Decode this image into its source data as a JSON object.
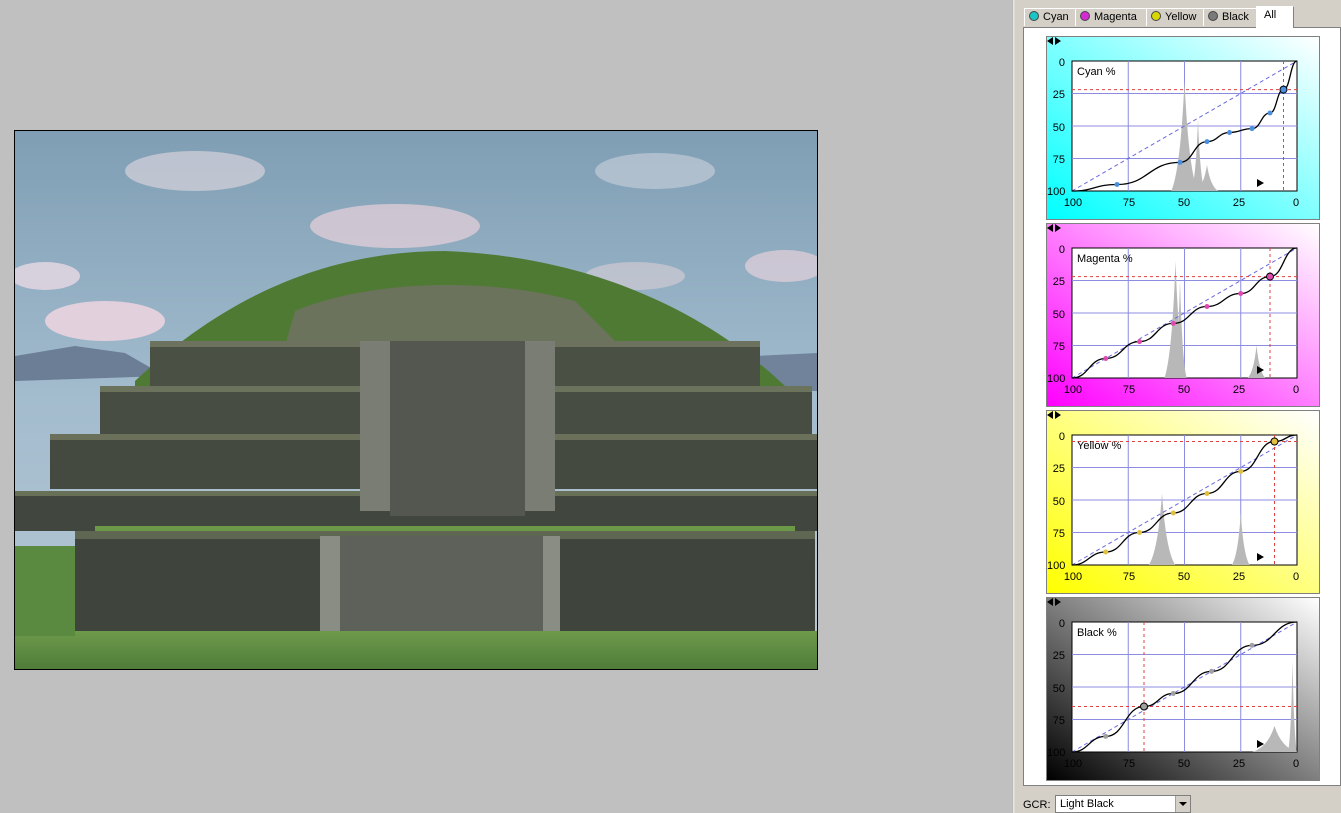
{
  "tabs": [
    {
      "label": "Cyan",
      "dot_color": "#19c5c5"
    },
    {
      "label": "Magenta",
      "dot_color": "#d42ad4"
    },
    {
      "label": "Yellow",
      "dot_color": "#d8d800"
    },
    {
      "label": "Black",
      "dot_color": "#7a7a7a"
    },
    {
      "label": "All",
      "dot_color": ""
    }
  ],
  "active_tab": "All",
  "curves": [
    {
      "label": "Cyan %",
      "color": "#00ffff",
      "y_ticks": [
        "0",
        "25",
        "50",
        "75",
        "100"
      ],
      "x_ticks": [
        "100",
        "75",
        "50",
        "25",
        "0"
      ]
    },
    {
      "label": "Magenta %",
      "color": "#ff00ff",
      "y_ticks": [
        "0",
        "25",
        "50",
        "75",
        "100"
      ],
      "x_ticks": [
        "100",
        "75",
        "50",
        "25",
        "0"
      ]
    },
    {
      "label": "Yellow %",
      "color": "#ffff00",
      "y_ticks": [
        "0",
        "25",
        "50",
        "75",
        "100"
      ],
      "x_ticks": [
        "100",
        "75",
        "50",
        "25",
        "0"
      ]
    },
    {
      "label": "Black %",
      "color": "#000000",
      "y_ticks": [
        "0",
        "25",
        "50",
        "75",
        "100"
      ],
      "x_ticks": [
        "100",
        "75",
        "50",
        "25",
        "0"
      ]
    }
  ],
  "gcr": {
    "label": "GCR:",
    "value": "Light Black"
  }
}
